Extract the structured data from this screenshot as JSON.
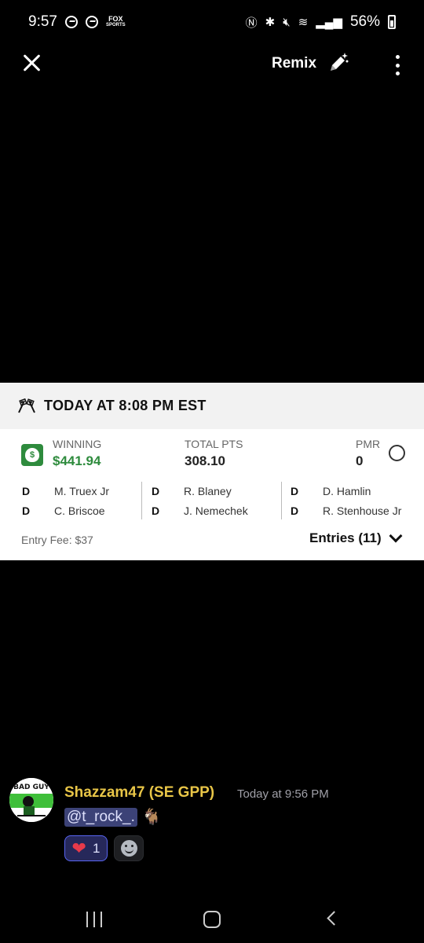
{
  "status_bar": {
    "time": "9:57",
    "battery": "56%",
    "fox_line1": "FOX",
    "fox_line2": "SPORTS"
  },
  "toolbar": {
    "remix_label": "Remix"
  },
  "card": {
    "title": "TODAY AT 8:08 PM EST",
    "stats": {
      "winning_label": "WINNING",
      "winning_value": "$441.94",
      "total_label": "TOTAL PTS",
      "total_value": "308.10",
      "pmr_label": "PMR",
      "pmr_value": "0"
    },
    "drivers": [
      {
        "pos": "D",
        "name": "M. Truex Jr"
      },
      {
        "pos": "D",
        "name": "R. Blaney"
      },
      {
        "pos": "D",
        "name": "D. Hamlin"
      },
      {
        "pos": "D",
        "name": "C. Briscoe"
      },
      {
        "pos": "D",
        "name": "J. Nemechek"
      },
      {
        "pos": "D",
        "name": "R. Stenhouse Jr"
      }
    ],
    "entry_fee": "Entry Fee: $37",
    "entries_label": "Entries (11)"
  },
  "message": {
    "author": "Shazzam47 (SE GPP)",
    "timestamp": "Today at 9:56 PM",
    "mention": "@t_rock_.",
    "goat_emoji": "🐐",
    "reaction_emoji": "❤",
    "reaction_count": "1"
  },
  "colors": {
    "green": "#2e8b3d",
    "author_gold": "#e8c547",
    "mention_bg": "#3c4277"
  }
}
